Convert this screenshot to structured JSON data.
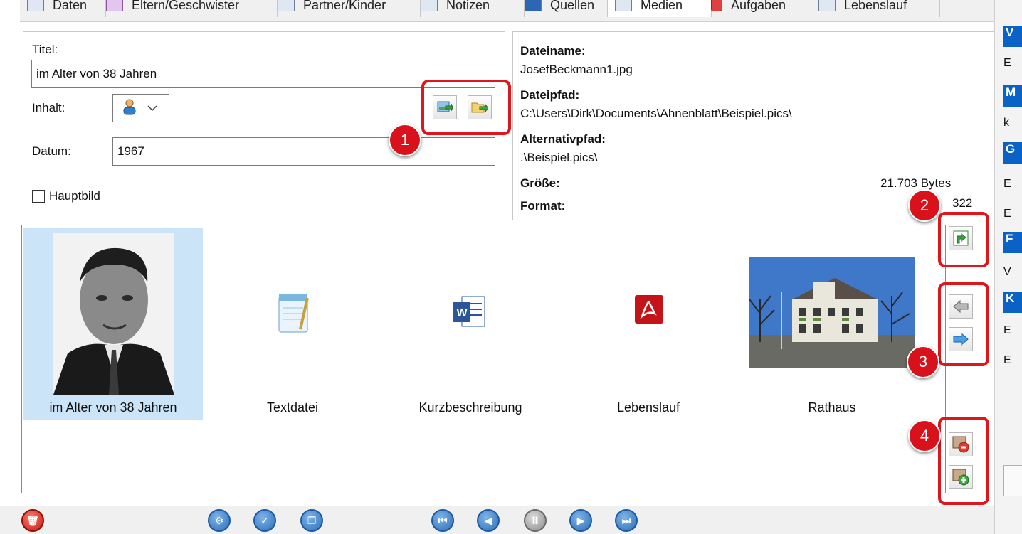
{
  "tabs": [
    {
      "label": "Daten"
    },
    {
      "label": "Eltern/Geschwister"
    },
    {
      "label": "Partner/Kinder"
    },
    {
      "label": "Notizen"
    },
    {
      "label": "Quellen"
    },
    {
      "label": "Medien"
    },
    {
      "label": "Aufgaben"
    },
    {
      "label": "Lebenslauf"
    }
  ],
  "form": {
    "title_label": "Titel:",
    "title_value": "im Alter von 38 Jahren",
    "content_label": "Inhalt:",
    "date_label": "Datum:",
    "date_value": "1967",
    "main_image_label": "Hauptbild"
  },
  "info": {
    "filename_label": "Dateiname:",
    "filename_value": "JosefBeckmann1.jpg",
    "filepath_label": "Dateipfad:",
    "filepath_value": "C:\\Users\\Dirk\\Documents\\Ahnenblatt\\Beispiel.pics\\",
    "altpath_label": "Alternativpfad:",
    "altpath_value": ".\\Beispiel.pics\\",
    "size_label": "Größe:",
    "size_value": "21.703 Bytes",
    "format_label": "Format:",
    "format_value": "322"
  },
  "gallery": [
    {
      "caption": "im Alter von 38 Jahren",
      "icon": "portrait-photo"
    },
    {
      "caption": "Textdatei",
      "icon": "notepad-icon"
    },
    {
      "caption": "Kurzbeschreibung",
      "icon": "word-icon"
    },
    {
      "caption": "Lebenslauf",
      "icon": "pdf-icon"
    },
    {
      "caption": "Rathaus",
      "icon": "building-photo"
    }
  ],
  "callouts": [
    "1",
    "2",
    "3",
    "4"
  ],
  "right_strip": [
    "V",
    "E",
    "M",
    "k",
    "G",
    "E",
    "E",
    "F",
    "V",
    "K",
    "E",
    "E"
  ],
  "colors": {
    "callout": "#e0161c",
    "accent": "#0a62c6",
    "selection": "#cce4f7"
  }
}
